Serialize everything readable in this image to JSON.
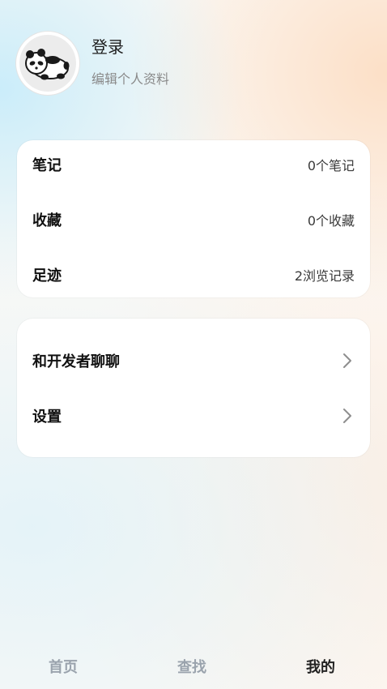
{
  "profile": {
    "avatar_icon": "panda-icon",
    "login_label": "登录",
    "edit_label": "编辑个人资料"
  },
  "stats": [
    {
      "label": "笔记",
      "value": "0个笔记"
    },
    {
      "label": "收藏",
      "value": "0个收藏"
    },
    {
      "label": "足迹",
      "value": "2浏览记录"
    }
  ],
  "menu": [
    {
      "label": "和开发者聊聊",
      "icon": "chevron-right-icon"
    },
    {
      "label": "设置",
      "icon": "chevron-right-icon"
    }
  ],
  "tabbar": {
    "tabs": [
      "首页",
      "查找",
      "我的"
    ],
    "active_index": 2,
    "active_color": "#222222",
    "inactive_color": "#9aa3ad"
  }
}
